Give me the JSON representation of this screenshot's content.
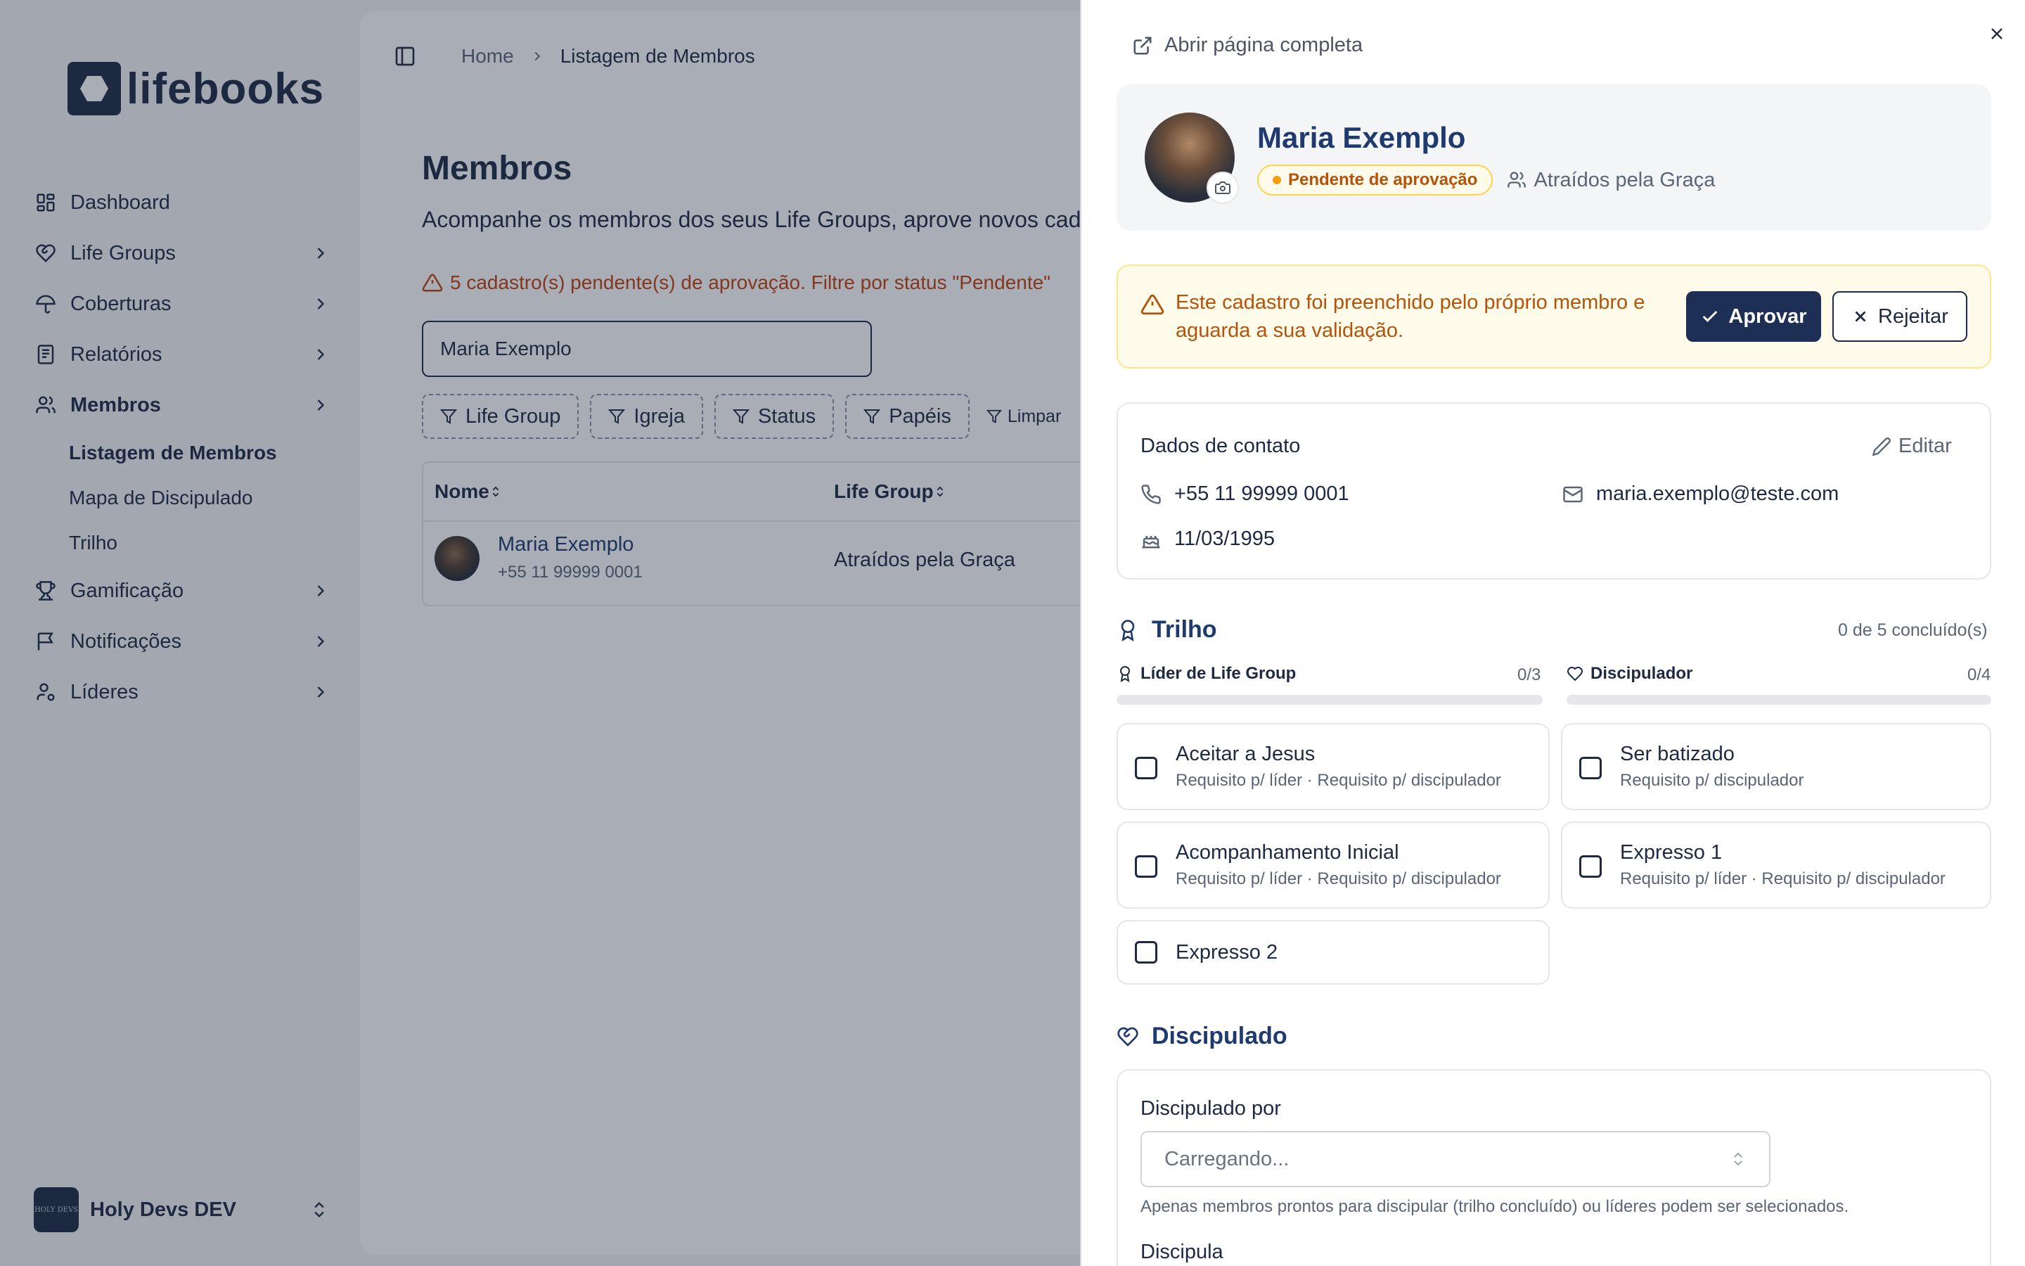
{
  "brand": {
    "name": "lifebooks"
  },
  "sidebar": {
    "items": [
      {
        "label": "Dashboard",
        "icon": "dashboard-icon",
        "has_chevron": false
      },
      {
        "label": "Life Groups",
        "icon": "heart-handshake-icon",
        "has_chevron": true
      },
      {
        "label": "Coberturas",
        "icon": "umbrella-icon",
        "has_chevron": true
      },
      {
        "label": "Relatórios",
        "icon": "report-icon",
        "has_chevron": true
      },
      {
        "label": "Membros",
        "icon": "users-icon",
        "has_chevron": true,
        "active": true
      },
      {
        "label": "Gamificação",
        "icon": "trophy-icon",
        "has_chevron": true
      },
      {
        "label": "Notificações",
        "icon": "message-flag-icon",
        "has_chevron": true
      },
      {
        "label": "Líderes",
        "icon": "user-cog-icon",
        "has_chevron": true
      }
    ],
    "sub_items": [
      {
        "label": "Listagem de Membros",
        "active": true
      },
      {
        "label": "Mapa de Discipulado"
      },
      {
        "label": "Trilho"
      }
    ],
    "org": {
      "name": "Holy Devs DEV",
      "avatar_text": "HOLY DEVS"
    }
  },
  "breadcrumb": {
    "home": "Home",
    "current": "Listagem de Membros"
  },
  "page": {
    "title": "Membros",
    "subtitle": "Acompanhe os membros dos seus Life Groups, aprove novos cad",
    "warning": "5 cadastro(s) pendente(s) de aprovação. Filtre por status \"Pendente\"",
    "search_value": "Maria Exemplo",
    "filters": [
      "Life Group",
      "Igreja",
      "Status",
      "Papéis"
    ],
    "clear_label": "Limpar",
    "table": {
      "headers": [
        "Nome",
        "Life Group"
      ],
      "rows": [
        {
          "name": "Maria Exemplo",
          "phone": "+55 11 99999 0001",
          "life_group": "Atraídos pela Graça"
        }
      ]
    }
  },
  "panel": {
    "open_full": "Abrir página completa",
    "member": {
      "name": "Maria Exemplo",
      "status": "Pendente de aprovação",
      "group": "Atraídos pela Graça"
    },
    "alert": {
      "text": "Este cadastro foi preenchido pelo próprio membro e aguarda a sua validação.",
      "approve": "Aprovar",
      "reject": "Rejeitar"
    },
    "contact": {
      "title": "Dados de contato",
      "edit": "Editar",
      "phone": "+55 11 99999 0001",
      "email": "maria.exemplo@teste.com",
      "birthday": "11/03/1995"
    },
    "trilho": {
      "title": "Trilho",
      "summary": "0 de 5 concluído(s)",
      "tracks": [
        {
          "label": "Líder de Life Group",
          "count": "0/3",
          "progress": 0
        },
        {
          "label": "Discipulador",
          "count": "0/4",
          "progress": 0
        }
      ],
      "steps": [
        {
          "title": "Aceitar a Jesus",
          "sub": "Requisito p/ líder · Requisito p/ discipulador",
          "checked": false
        },
        {
          "title": "Ser batizado",
          "sub": "Requisito p/ discipulador",
          "checked": false
        },
        {
          "title": "Acompanhamento Inicial",
          "sub": "Requisito p/ líder · Requisito p/ discipulador",
          "checked": false
        },
        {
          "title": "Expresso 1",
          "sub": "Requisito p/ líder · Requisito p/ discipulador",
          "checked": false
        },
        {
          "title": "Expresso 2",
          "sub": "",
          "checked": false
        }
      ]
    },
    "discipulado": {
      "title": "Discipulado",
      "by_label": "Discipulado por",
      "select_value": "Carregando...",
      "help": "Apenas membros prontos para discipular (trilho concluído) ou líderes podem ser selecionados.",
      "disciples_label": "Discipula"
    }
  }
}
